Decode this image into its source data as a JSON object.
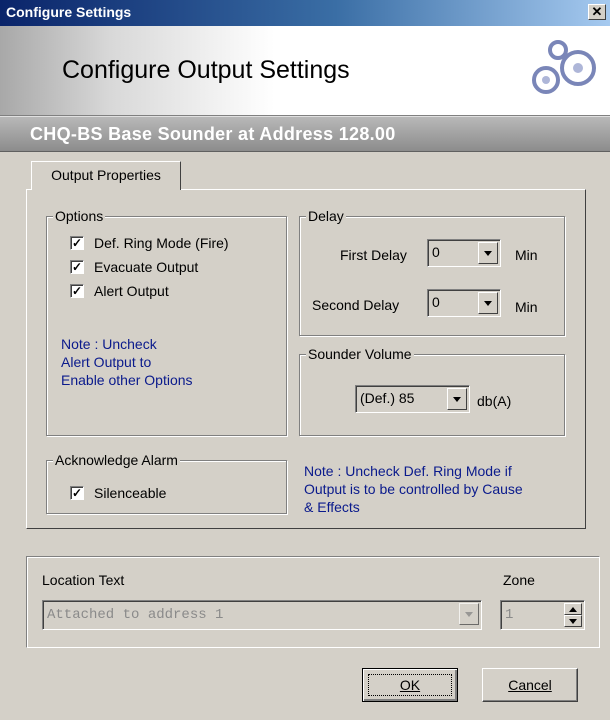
{
  "window": {
    "title": "Configure Settings",
    "close_glyph": "✕"
  },
  "header": {
    "title": "Configure Output Settings",
    "logo_icon": "gears-icon"
  },
  "device": {
    "description": "CHQ-BS Base Sounder at Address 128.00"
  },
  "tabs": [
    {
      "label": "Output Properties",
      "selected": true
    }
  ],
  "options": {
    "legend": "Options",
    "checkboxes": [
      {
        "label": "Def. Ring Mode (Fire)",
        "checked": true
      },
      {
        "label": "Evacuate Output",
        "checked": true
      },
      {
        "label": "Alert Output",
        "checked": true
      }
    ],
    "note": [
      "Note : Uncheck",
      "Alert Output to",
      "Enable other Options"
    ]
  },
  "delay": {
    "legend": "Delay",
    "first_label": "First Delay",
    "first_value": "0",
    "first_unit": "Min",
    "second_label": "Second Delay",
    "second_value": "0",
    "second_unit": "Min"
  },
  "sounder_volume": {
    "legend": "Sounder Volume",
    "value": "(Def.) 85",
    "unit": "db(A)"
  },
  "acknowledge": {
    "legend": "Acknowledge Alarm",
    "checkbox_label": "Silenceable",
    "checked": true
  },
  "ring_mode_note": [
    "Note : Uncheck Def. Ring Mode if",
    "Output is to be controlled by Cause",
    "& Effects"
  ],
  "location": {
    "label": "Location Text",
    "value": "Attached to address 1"
  },
  "zone": {
    "label": "Zone",
    "value": "1"
  },
  "buttons": {
    "ok": "OK",
    "cancel": "Cancel"
  },
  "colors": {
    "note_text": "#0a1a8c",
    "title_bar": "#0a246a",
    "face": "#d4d0c8"
  }
}
